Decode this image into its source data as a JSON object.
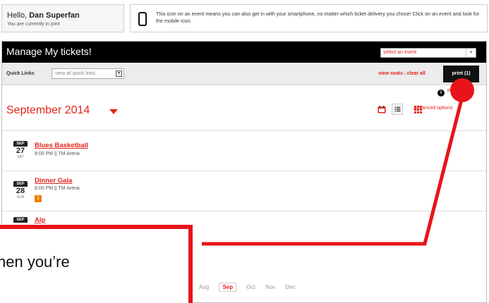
{
  "user": {
    "greeting": "Hello,",
    "name": "Dan Superfan",
    "status": "You are currently in joint"
  },
  "notice": {
    "icon": "smartphone-icon",
    "text": "This icon on an event means you can also get in with your smartphone, no matter which ticket delivery you chose! Click on an event and look for the mobile icon."
  },
  "panel": {
    "title": "Manage My tickets!",
    "event_select_placeholder": "select an event"
  },
  "toolbar": {
    "quick_links_label": "Quick Links",
    "quick_links_value": "view all quick links",
    "view_seats": "view seats",
    "separator": "|",
    "clear_all": "clear all",
    "print_label": "print (1)"
  },
  "print_hint": "Print",
  "month": {
    "title": "September 2014",
    "advanced_label": "Advanced options"
  },
  "events": [
    {
      "month": "SEP",
      "day": "27",
      "dow": "SAT",
      "name": "Blues Basketball",
      "meta": "8:00 PM || TM Arena",
      "count": ""
    },
    {
      "month": "SEP",
      "day": "28",
      "dow": "SUN",
      "name": "Dinner Gala",
      "meta": "8:00 PM || TM Arena",
      "count": "1"
    },
    {
      "month": "SEP",
      "day": "",
      "dow": "",
      "name": "Alp",
      "meta": "",
      "count": ""
    }
  ],
  "month_nav": [
    "Aug",
    "Sep",
    "Oct",
    "Nov",
    "Dec"
  ],
  "month_nav_active": "Sep",
  "callout": {
    "text": "hen you’re"
  },
  "colors": {
    "accent": "#e2231a",
    "callout": "#e8141a",
    "header": "#000000",
    "badge": "#f07d00"
  }
}
